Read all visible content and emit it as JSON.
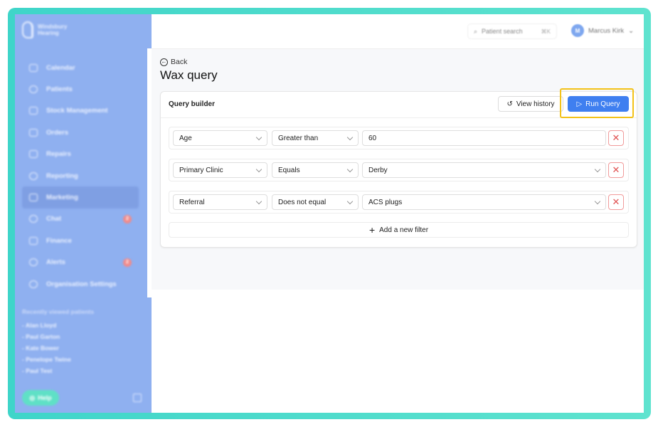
{
  "sidebar": {
    "brand_line1": "Windsbury",
    "brand_line2": "Hearing",
    "items": [
      {
        "label": "Calendar"
      },
      {
        "label": "Patients"
      },
      {
        "label": "Stock Management"
      },
      {
        "label": "Orders"
      },
      {
        "label": "Repairs"
      },
      {
        "label": "Reporting"
      },
      {
        "label": "Marketing",
        "active": true
      },
      {
        "label": "Chat",
        "badge": "2"
      },
      {
        "label": "Finance"
      },
      {
        "label": "Alerts",
        "badge": "2"
      },
      {
        "label": "Organisation Settings"
      }
    ],
    "recent_title": "Recently viewed patients",
    "recent": [
      "- Alan Lloyd",
      "- Paul Garton",
      "- Kate Bower",
      "- Penelope Twine",
      "- Paul Test"
    ],
    "help_label": "Help"
  },
  "header": {
    "search_placeholder": "Patient search",
    "search_shortcut": "⌘K",
    "user_initial": "M",
    "user_name": "Marcus Kirk"
  },
  "main": {
    "back_label": "Back",
    "title": "Wax query",
    "card_title": "Query builder",
    "view_history_label": "View history",
    "run_query_label": "Run Query",
    "filters": [
      {
        "field": "Age",
        "operator": "Greater than",
        "value": "60"
      },
      {
        "field": "Primary Clinic",
        "operator": "Equals",
        "value": "Derby"
      },
      {
        "field": "Referral",
        "operator": "Does not equal",
        "value": "ACS plugs"
      }
    ],
    "add_filter_label": "Add a new filter"
  },
  "colors": {
    "sidebar_bg": "#8fb0f0",
    "frame_accent": "#3fd5c9",
    "primary": "#3f7ff0",
    "highlight": "#f3c218",
    "danger": "#e05252"
  }
}
